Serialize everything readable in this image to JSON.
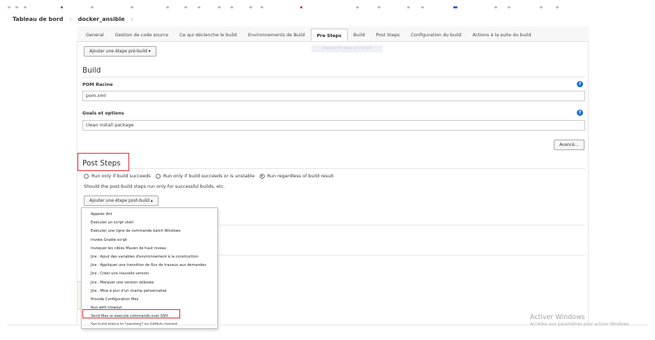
{
  "breadcrumb": {
    "root": "Tableau de bord",
    "job": "docker_ansible",
    "separator": "›"
  },
  "tabs": [
    {
      "label": "General"
    },
    {
      "label": "Gestion de code source"
    },
    {
      "label": "Ce qui déclenche le build"
    },
    {
      "label": "Environnements de Build"
    },
    {
      "label": "Pre Steps",
      "active": true
    },
    {
      "label": "Build"
    },
    {
      "label": "Post Steps"
    },
    {
      "label": "Configuration du build"
    },
    {
      "label": "Actions à la suite du build"
    }
  ],
  "pre_steps": {
    "add_button": "Ajouter une étape pré-build ▾",
    "ghost_button": "Déplacer Pre steps vers le haut"
  },
  "build": {
    "title": "Build",
    "pom_label": "POM Racine",
    "pom_value": "pom.xml",
    "goals_label": "Goals et options",
    "goals_value": "clean install package",
    "advanced_button": "Avancé...",
    "help_glyph": "?"
  },
  "post_steps": {
    "title": "Post Steps",
    "radios": [
      {
        "label": "Run only if build succeeds",
        "checked": false
      },
      {
        "label": "Run only if build succeeds or is unstable",
        "checked": false
      },
      {
        "label": "Run regardless of build result",
        "checked": true
      }
    ],
    "help_text": "Should the post-build steps run only for successful builds, etc.",
    "add_button": "Ajouter une étape post-build ▴"
  },
  "dropdown": {
    "items": [
      "Appeler Ant",
      "Exécuter un script shell",
      "Exécuter une ligne de commande batch Windows",
      "Invoke Gradle script",
      "Invoquer les cibles Maven de haut niveau",
      "Jira : Ajout des variables d'environnement à la construction",
      "Jira : Appliquer une transition de flux de travaux aux demandes",
      "Jira : Créer une nouvelle version",
      "Jira : Marquer une version relâssée",
      "Jira : Mise à jour d'un champ personnalisé",
      "Provide Configuration files",
      "Run with timeout",
      "Send files or execute commands over SSH",
      "Set build status to \"pending\" on GitHub commit"
    ],
    "highlighted_index": 12
  },
  "watermark": {
    "line1": "Activer Windows",
    "line2": "Accédez aux paramètres pour activer Windows."
  },
  "colors": {
    "highlight_red": "#d9232d",
    "help_blue": "#1b6fd1"
  }
}
